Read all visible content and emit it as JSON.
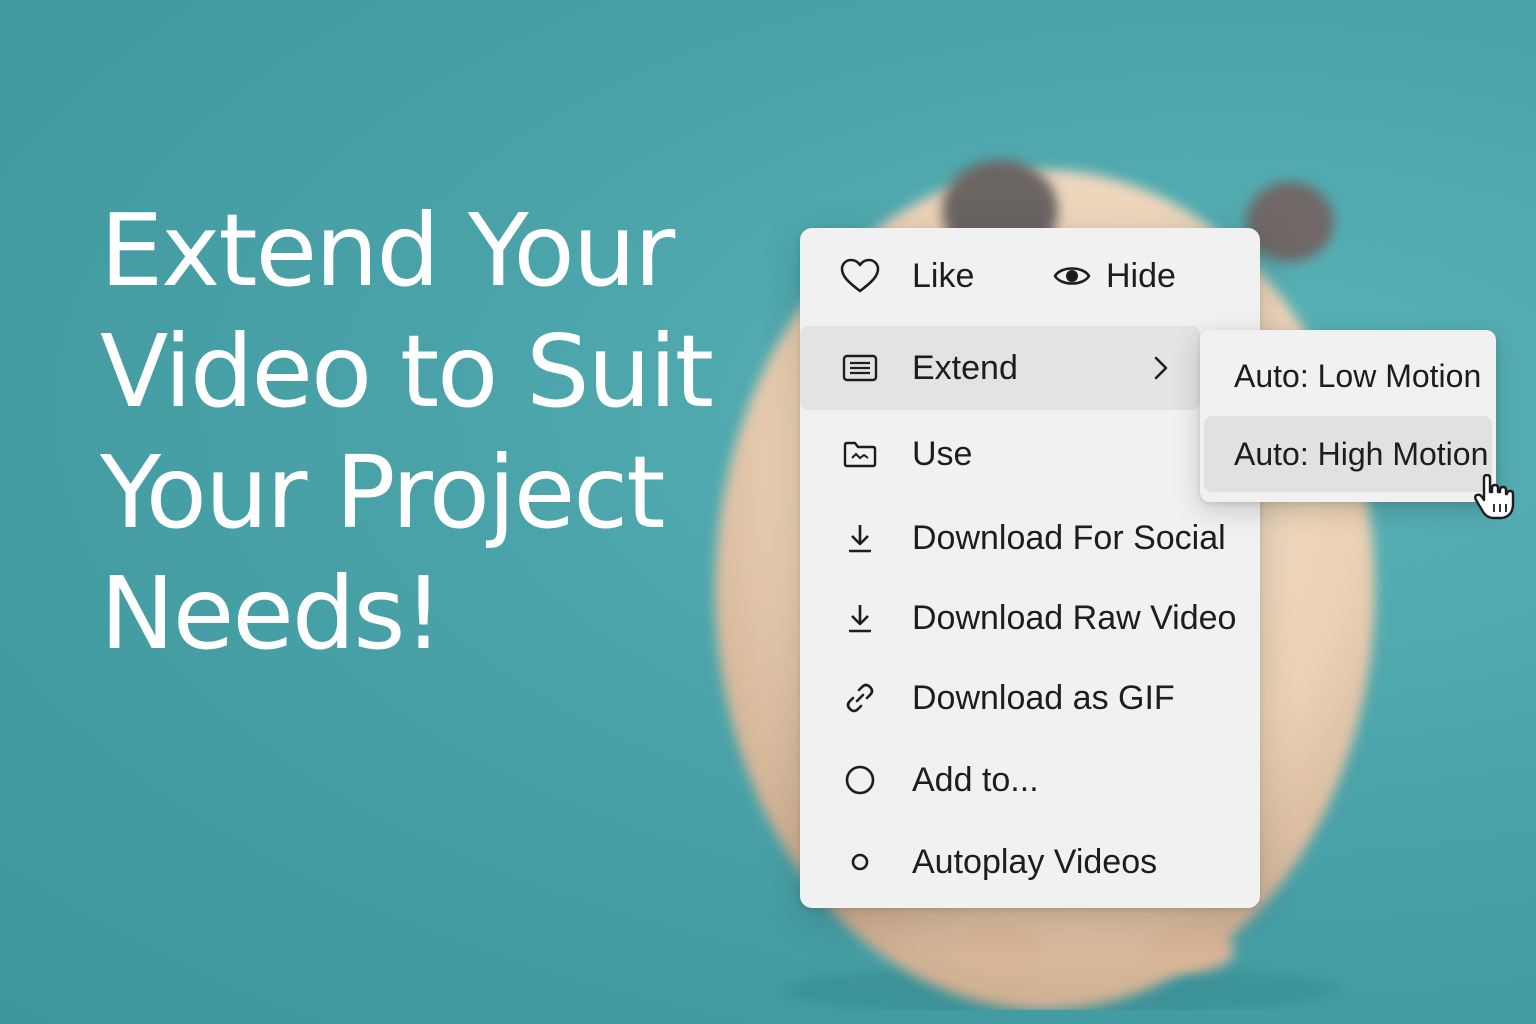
{
  "headline": {
    "line1": "Extend Your",
    "line2": "Video to Suit",
    "line3": "Your Project",
    "line4": "Needs!"
  },
  "menu": {
    "like_label": "Like",
    "hide_label": "Hide",
    "items": [
      {
        "label": "Extend",
        "icon": "list-icon",
        "has_submenu": true
      },
      {
        "label": "Use",
        "icon": "folder-icon"
      },
      {
        "label": "Download For Social",
        "icon": "download-icon"
      },
      {
        "label": "Download Raw Video",
        "icon": "download-icon"
      },
      {
        "label": "Download as GIF",
        "icon": "link-icon"
      },
      {
        "label": "Add to...",
        "icon": "circle-icon"
      },
      {
        "label": "Autoplay Videos",
        "icon": "small-circle-icon"
      }
    ]
  },
  "submenu": {
    "items": [
      {
        "label": "Auto: Low Motion"
      },
      {
        "label": "Auto: High Motion"
      }
    ]
  },
  "colors": {
    "background": "#4aa3a9",
    "menu_bg": "#f2f1f1",
    "active_bg": "#e4e3e3",
    "text": "#1d1d1f"
  }
}
